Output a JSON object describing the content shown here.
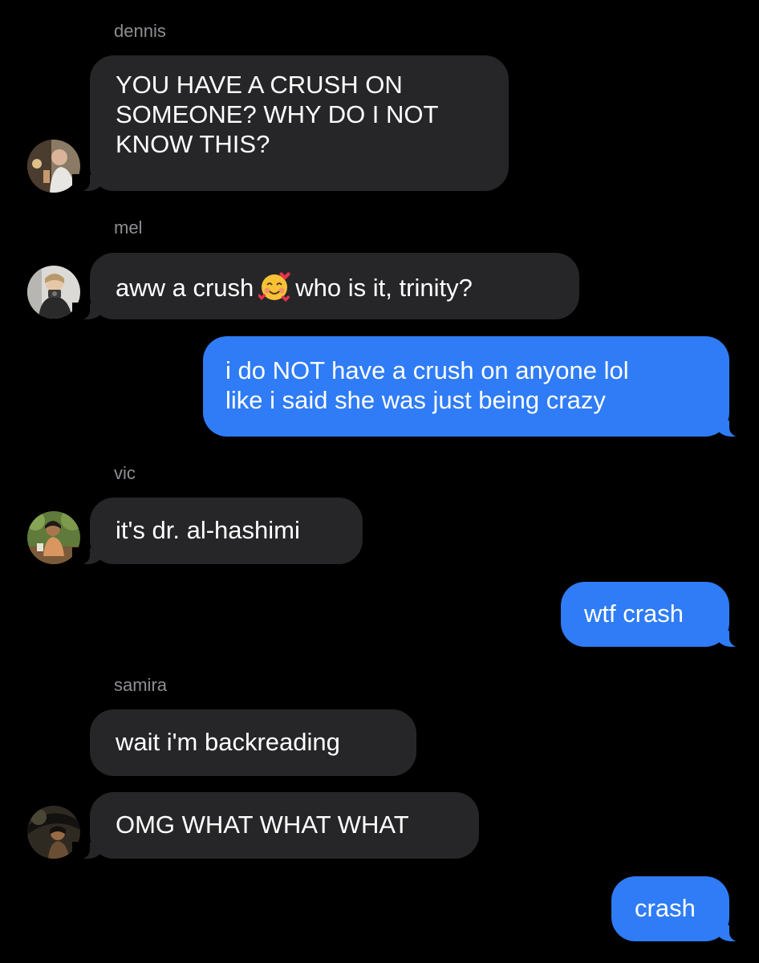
{
  "conversation": [
    {
      "id": "m1",
      "direction": "incoming",
      "sender": "dennis",
      "lines": [
        "YOU HAVE A CRUSH ON",
        "SOMEONE? WHY DO I NOT",
        "KNOW THIS?"
      ],
      "avatar_icon": "dennis-avatar-photo"
    },
    {
      "id": "m2",
      "direction": "incoming",
      "sender": "mel",
      "text_before_emoji": "aww a crush",
      "emoji": "smiling-face-with-hearts-emoji",
      "text_after_emoji": "who is it, trinity?",
      "avatar_icon": "mel-avatar-photo"
    },
    {
      "id": "m3",
      "direction": "outgoing",
      "lines": [
        "i do NOT have a crush on anyone lol",
        "like i said she was just being crazy"
      ]
    },
    {
      "id": "m4",
      "direction": "incoming",
      "sender": "vic",
      "lines": [
        "it's dr. al-hashimi"
      ],
      "avatar_icon": "vic-avatar-photo"
    },
    {
      "id": "m5",
      "direction": "outgoing",
      "lines": [
        "wtf crash"
      ]
    },
    {
      "id": "m6",
      "direction": "incoming",
      "sender": "samira",
      "lines": [
        "wait i'm backreading"
      ]
    },
    {
      "id": "m7",
      "direction": "incoming",
      "lines": [
        "OMG WHAT WHAT WHAT"
      ],
      "avatar_icon": "samira-avatar-photo"
    },
    {
      "id": "m8",
      "direction": "outgoing",
      "lines": [
        "crash"
      ]
    }
  ],
  "colors": {
    "background": "#000000",
    "incoming_bubble": "#262628",
    "outgoing_bubble": "#2f7cf6",
    "sender_label": "#8e8e93",
    "message_text": "#ffffff"
  }
}
